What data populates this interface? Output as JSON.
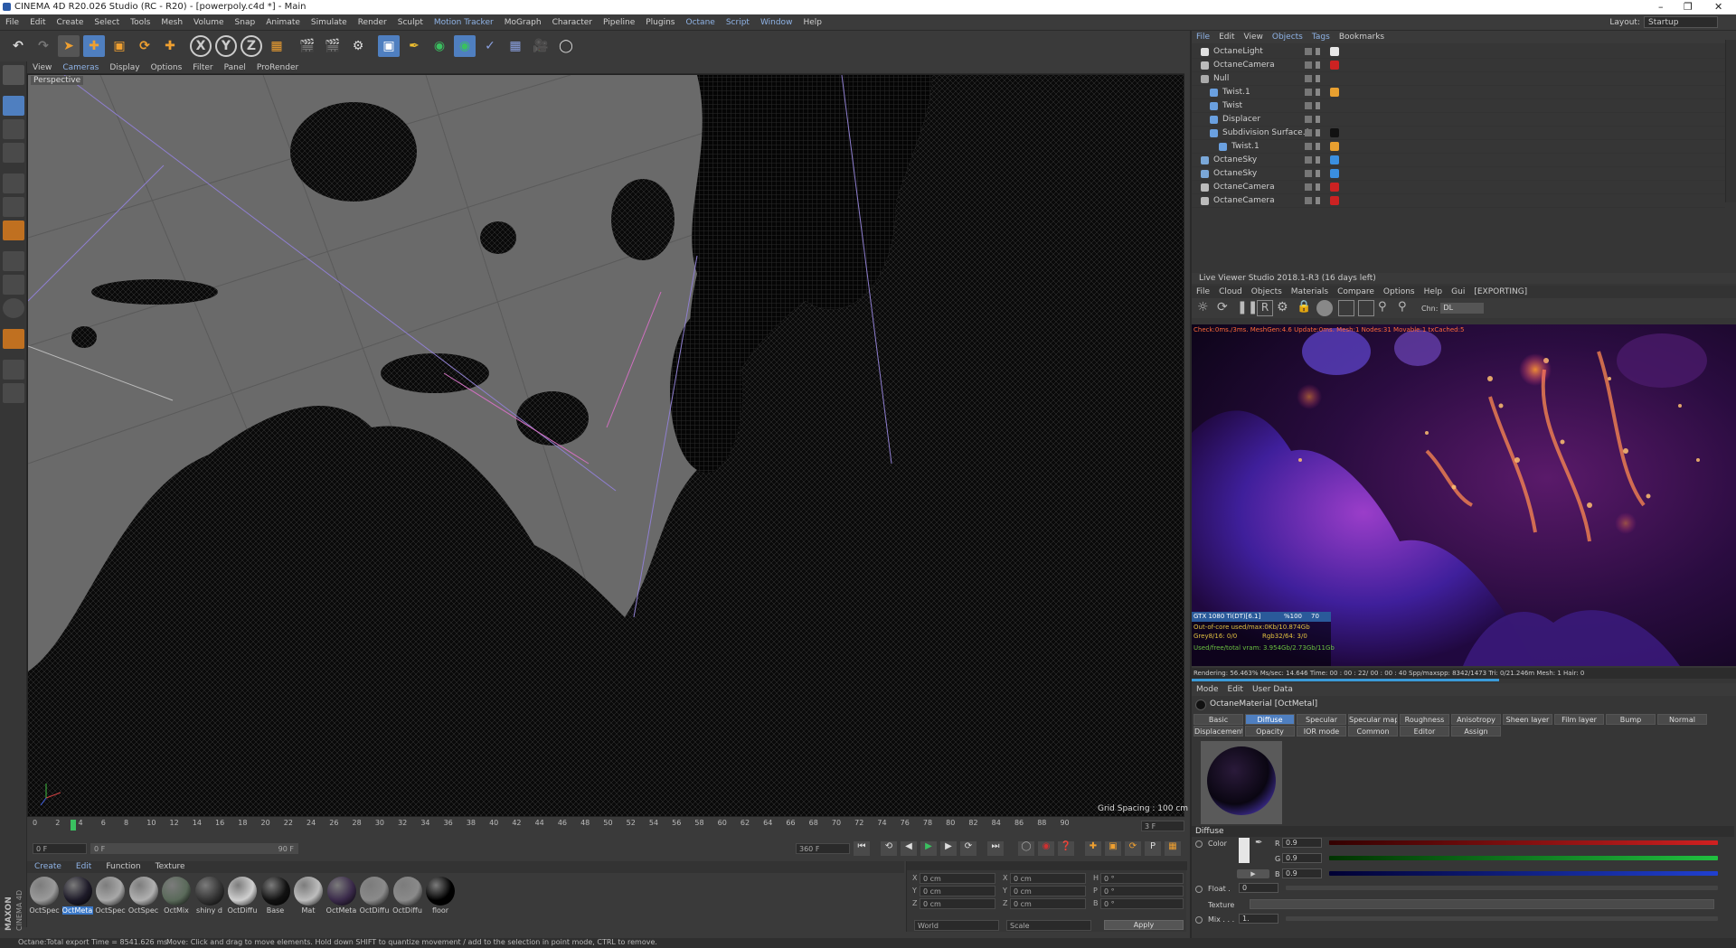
{
  "title": "CINEMA 4D R20.026 Studio (RC - R20) - [powerpoly.c4d *] - Main",
  "menu": [
    "File",
    "Edit",
    "Create",
    "Select",
    "Tools",
    "Mesh",
    "Volume",
    "Snap",
    "Animate",
    "Simulate",
    "Render",
    "Sculpt",
    "Motion Tracker",
    "MoGraph",
    "Character",
    "Pipeline",
    "Plugins",
    "Octane",
    "Script",
    "Window",
    "Help"
  ],
  "layout": {
    "label": "Layout:",
    "value": "Startup"
  },
  "viewport": {
    "menu": [
      "View",
      "Cameras",
      "Display",
      "Options",
      "Filter",
      "Panel",
      "ProRender"
    ],
    "label": "Perspective",
    "grid_spacing": "Grid Spacing : 100 cm"
  },
  "timeline": {
    "ticks": [
      "0",
      "2",
      "4",
      "6",
      "8",
      "10",
      "12",
      "14",
      "16",
      "18",
      "20",
      "22",
      "24",
      "26",
      "28",
      "30",
      "32",
      "34",
      "36",
      "38",
      "40",
      "42",
      "44",
      "46",
      "48",
      "50",
      "52",
      "54",
      "56",
      "58",
      "60",
      "62",
      "64",
      "66",
      "68",
      "70",
      "72",
      "74",
      "76",
      "78",
      "80",
      "82",
      "84",
      "86",
      "88",
      "90"
    ],
    "current_frame": "3 F",
    "start": "0 F",
    "range_start": "0 F",
    "range_end": "90 F",
    "end": "360 F"
  },
  "material_manager": {
    "menu": [
      "Create",
      "Edit",
      "Function",
      "Texture"
    ],
    "materials": [
      {
        "label": "OctSpec",
        "color": "#9a9a9a"
      },
      {
        "label": "OctMeta",
        "color": "#1d1a28",
        "selected": true
      },
      {
        "label": "OctSpec",
        "color": "#a8a8a8"
      },
      {
        "label": "OctSpec",
        "color": "#b0b0b0"
      },
      {
        "label": "OctMix",
        "color": "#5a6a5a"
      },
      {
        "label": "shiny d",
        "color": "#333333"
      },
      {
        "label": "OctDiffu",
        "color": "#cfcfcf"
      },
      {
        "label": "Base",
        "color": "#111111"
      },
      {
        "label": "Mat",
        "color": "#bdbdbd"
      },
      {
        "label": "OctMeta",
        "color": "#3a2a4a"
      },
      {
        "label": "OctDiffu",
        "color": "#8a8a8a"
      },
      {
        "label": "OctDiffu",
        "color": "#8a8a8a"
      },
      {
        "label": "floor",
        "color": "#000000"
      }
    ]
  },
  "coordinates": {
    "rows": [
      {
        "a": "X",
        "av": "0 cm",
        "b": "X",
        "bv": "0 cm",
        "c": "H",
        "cv": "0 °"
      },
      {
        "a": "Y",
        "av": "0 cm",
        "b": "Y",
        "bv": "0 cm",
        "c": "P",
        "cv": "0 °"
      },
      {
        "a": "Z",
        "av": "0 cm",
        "b": "Z",
        "bv": "0 cm",
        "c": "B",
        "cv": "0 °"
      }
    ],
    "mode1": "World",
    "mode2": "Scale",
    "apply": "Apply"
  },
  "status": {
    "left": "Octane:Total export Time = 8541.626 ms",
    "right": "Move: Click and drag to move elements. Hold down SHIFT to quantize movement / add to the selection in point mode, CTRL to remove."
  },
  "object_manager": {
    "menu": [
      "File",
      "Edit",
      "View",
      "Objects",
      "Tags",
      "Bookmarks"
    ],
    "objects": [
      {
        "name": "OctaneLight",
        "indent": 0,
        "icon": "#e0e0e0",
        "tag": "#e8e8e8"
      },
      {
        "name": "OctaneCamera",
        "indent": 0,
        "icon": "#bbbbbb",
        "tag": "#cc2222"
      },
      {
        "name": "Null",
        "indent": 0,
        "icon": "#aaaaaa",
        "tag": ""
      },
      {
        "name": "Twist.1",
        "indent": 1,
        "icon": "#6aa0e0",
        "tag": "#e8a030"
      },
      {
        "name": "Twist",
        "indent": 1,
        "icon": "#6aa0e0",
        "tag": ""
      },
      {
        "name": "Displacer",
        "indent": 1,
        "icon": "#6aa0e0",
        "tag": ""
      },
      {
        "name": "Subdivision Surface.1",
        "indent": 1,
        "icon": "#6aa0e0",
        "tag": "#111111"
      },
      {
        "name": "Twist.1",
        "indent": 2,
        "icon": "#6aa0e0",
        "tag": "#e8a030"
      },
      {
        "name": "OctaneSky",
        "indent": 0,
        "icon": "#7aa7d8",
        "tag": "#3a8fe0"
      },
      {
        "name": "OctaneSky",
        "indent": 0,
        "icon": "#7aa7d8",
        "tag": "#3a8fe0"
      },
      {
        "name": "OctaneCamera",
        "indent": 0,
        "icon": "#bbbbbb",
        "tag": "#cc2222"
      },
      {
        "name": "OctaneCamera",
        "indent": 0,
        "icon": "#bbbbbb",
        "tag": "#cc2222"
      }
    ]
  },
  "live_viewer": {
    "title": "Live Viewer Studio 2018.1-R3 (16 days left)",
    "menu": [
      "File",
      "Cloud",
      "Objects",
      "Materials",
      "Compare",
      "Options",
      "Help",
      "Gui",
      "[EXPORTING]"
    ],
    "channel_label": "Chn:",
    "channel_value": "DL",
    "overlay_top": "Check:0ms./3ms. MeshGen:4.6 Update:0ms. Mesh:1 Nodes:31 Movable:1 txCached:5",
    "gpu": [
      "GTX 1080 Ti(DT)[6.1]",
      "%100",
      "70"
    ],
    "ooc": "Out-of-core used/max:0Kb/10.874Gb",
    "grey": "Grey8/16: 0/0",
    "rgb": "Rgb32/64: 3/0",
    "vram": "Used/free/total vram: 3.954Gb/2.73Gb/11Gb",
    "status": "Rendering: 56.463%  Ms/sec: 14.646   Time: 00 : 00 : 22/ 00 : 00 : 40   Spp/maxspp: 8342/1473   Tri: 0/21.246m   Mesh: 1  Hair: 0"
  },
  "attributes": {
    "menu": [
      "Mode",
      "Edit",
      "User Data"
    ],
    "title": "OctaneMaterial [OctMetal]",
    "tabs_row1": [
      "Basic",
      "Diffuse",
      "Specular",
      "Specular map",
      "Roughness",
      "Anisotropy",
      "Sheen layer",
      "Film layer",
      "Bump",
      "Normal"
    ],
    "tabs_row2": [
      "Displacement",
      "Opacity",
      "IOR mode",
      "Common",
      "Editor",
      "Assign"
    ],
    "selected_tab": "Diffuse",
    "section": "Diffuse",
    "color_label": "Color",
    "r_label": "R",
    "r_value": "0.9",
    "g_label": "G",
    "g_value": "0.9",
    "b_label": "B",
    "b_value": "0.9",
    "float_label": "Float .",
    "float_value": "0",
    "texture_label": "Texture",
    "mix_label": "Mix . . .",
    "mix_value": "1."
  },
  "brand": "MAXON CINEMA 4D"
}
